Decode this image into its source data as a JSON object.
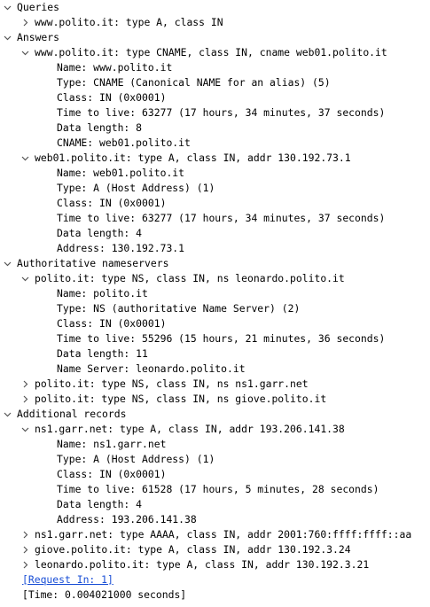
{
  "rows": [
    {
      "level": 0,
      "toggle": "expanded",
      "text": "Queries"
    },
    {
      "level": 1,
      "toggle": "collapsed",
      "text": "www.polito.it: type A, class IN"
    },
    {
      "level": 0,
      "toggle": "expanded",
      "text": "Answers"
    },
    {
      "level": 1,
      "toggle": "expanded",
      "text": "www.polito.it: type CNAME, class IN, cname web01.polito.it"
    },
    {
      "level": 2,
      "toggle": "none",
      "text": "Name: www.polito.it"
    },
    {
      "level": 2,
      "toggle": "none",
      "text": "Type: CNAME (Canonical NAME for an alias) (5)"
    },
    {
      "level": 2,
      "toggle": "none",
      "text": "Class: IN (0x0001)"
    },
    {
      "level": 2,
      "toggle": "none",
      "text": "Time to live: 63277 (17 hours, 34 minutes, 37 seconds)"
    },
    {
      "level": 2,
      "toggle": "none",
      "text": "Data length: 8"
    },
    {
      "level": 2,
      "toggle": "none",
      "text": "CNAME: web01.polito.it"
    },
    {
      "level": 1,
      "toggle": "expanded",
      "text": "web01.polito.it: type A, class IN, addr 130.192.73.1"
    },
    {
      "level": 2,
      "toggle": "none",
      "text": "Name: web01.polito.it"
    },
    {
      "level": 2,
      "toggle": "none",
      "text": "Type: A (Host Address) (1)"
    },
    {
      "level": 2,
      "toggle": "none",
      "text": "Class: IN (0x0001)"
    },
    {
      "level": 2,
      "toggle": "none",
      "text": "Time to live: 63277 (17 hours, 34 minutes, 37 seconds)"
    },
    {
      "level": 2,
      "toggle": "none",
      "text": "Data length: 4"
    },
    {
      "level": 2,
      "toggle": "none",
      "text": "Address: 130.192.73.1"
    },
    {
      "level": 0,
      "toggle": "expanded",
      "text": "Authoritative nameservers"
    },
    {
      "level": 1,
      "toggle": "expanded",
      "text": "polito.it: type NS, class IN, ns leonardo.polito.it"
    },
    {
      "level": 2,
      "toggle": "none",
      "text": "Name: polito.it"
    },
    {
      "level": 2,
      "toggle": "none",
      "text": "Type: NS (authoritative Name Server) (2)"
    },
    {
      "level": 2,
      "toggle": "none",
      "text": "Class: IN (0x0001)"
    },
    {
      "level": 2,
      "toggle": "none",
      "text": "Time to live: 55296 (15 hours, 21 minutes, 36 seconds)"
    },
    {
      "level": 2,
      "toggle": "none",
      "text": "Data length: 11"
    },
    {
      "level": 2,
      "toggle": "none",
      "text": "Name Server: leonardo.polito.it"
    },
    {
      "level": 1,
      "toggle": "collapsed",
      "text": "polito.it: type NS, class IN, ns ns1.garr.net"
    },
    {
      "level": 1,
      "toggle": "collapsed",
      "text": "polito.it: type NS, class IN, ns giove.polito.it"
    },
    {
      "level": 0,
      "toggle": "expanded",
      "text": "Additional records"
    },
    {
      "level": 1,
      "toggle": "expanded",
      "text": "ns1.garr.net: type A, class IN, addr 193.206.141.38"
    },
    {
      "level": 2,
      "toggle": "none",
      "text": "Name: ns1.garr.net"
    },
    {
      "level": 2,
      "toggle": "none",
      "text": "Type: A (Host Address) (1)"
    },
    {
      "level": 2,
      "toggle": "none",
      "text": "Class: IN (0x0001)"
    },
    {
      "level": 2,
      "toggle": "none",
      "text": "Time to live: 61528 (17 hours, 5 minutes, 28 seconds)"
    },
    {
      "level": 2,
      "toggle": "none",
      "text": "Data length: 4"
    },
    {
      "level": 2,
      "toggle": "none",
      "text": "Address: 193.206.141.38"
    },
    {
      "level": 1,
      "toggle": "collapsed",
      "text": "ns1.garr.net: type AAAA, class IN, addr 2001:760:ffff:ffff::aa"
    },
    {
      "level": 1,
      "toggle": "collapsed",
      "text": "giove.polito.it: type A, class IN, addr 130.192.3.24"
    },
    {
      "level": 1,
      "toggle": "collapsed",
      "text": "leonardo.polito.it: type A, class IN, addr 130.192.3.21"
    },
    {
      "level": 0,
      "toggle": "none",
      "link": true,
      "text": "[Request In: 1]"
    },
    {
      "level": 0,
      "toggle": "none",
      "text": "[Time: 0.004021000 seconds]"
    }
  ],
  "colors": {
    "text": "#000000",
    "link": "#1a4fd6",
    "toggle_icon": "#555555"
  }
}
